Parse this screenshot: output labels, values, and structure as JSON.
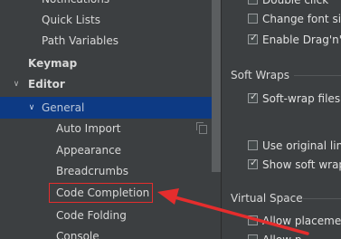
{
  "tree": {
    "items": [
      {
        "label": "Notifications"
      },
      {
        "label": "Quick Lists"
      },
      {
        "label": "Path Variables"
      },
      {
        "label": "Keymap"
      },
      {
        "label": "Editor",
        "arrow": "∨"
      },
      {
        "label": "General",
        "arrow": "∨"
      },
      {
        "label": "Auto Import"
      },
      {
        "label": "Appearance"
      },
      {
        "label": "Breadcrumbs"
      },
      {
        "label": "Code Completion"
      },
      {
        "label": "Code Folding"
      },
      {
        "label": "Console"
      }
    ]
  },
  "right": {
    "checkboxes": [
      {
        "label": "Double click",
        "checked": false
      },
      {
        "label": "Change font siz",
        "checked": false
      },
      {
        "label": "Enable Drag'n'D",
        "checked": true
      },
      {
        "label": "Soft-wrap files:",
        "checked": true
      },
      {
        "label": "Use original lin",
        "checked": false
      },
      {
        "label": "Show soft wrap",
        "checked": true
      },
      {
        "label": "Allow placemen",
        "checked": false
      },
      {
        "label": "Allow p",
        "checked": false
      }
    ],
    "sections": {
      "soft_wraps": "Soft Wraps",
      "virtual_space": "Virtual Space"
    }
  },
  "colors": {
    "background": "#3c3f41",
    "selection": "#0d3a84",
    "highlight": "#e52d2d"
  }
}
